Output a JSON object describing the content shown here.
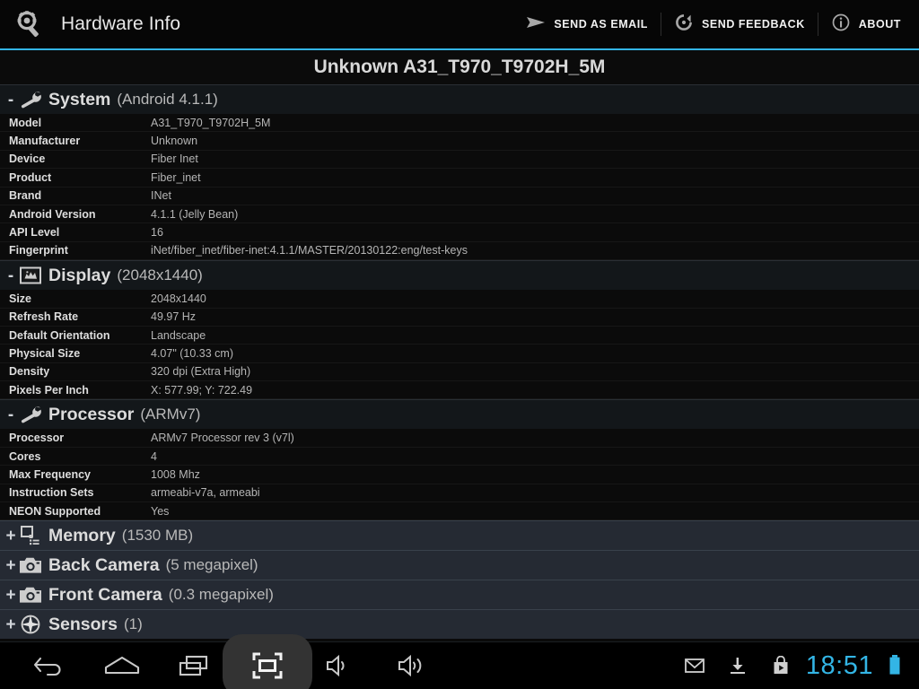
{
  "actionbar": {
    "app_icon": "magnifier-gear-icon",
    "title": "Hardware Info",
    "actions": [
      {
        "icon": "send-icon",
        "label": "SEND AS EMAIL"
      },
      {
        "icon": "feedback-refresh-icon",
        "label": "SEND FEEDBACK"
      },
      {
        "icon": "info-icon",
        "label": "ABOUT"
      }
    ],
    "accent_color": "#33b5e5"
  },
  "device_title": "Unknown A31_T970_T9702H_5M",
  "sections": [
    {
      "id": "system",
      "icon": "wrench-icon",
      "toggle": "-",
      "expanded": true,
      "name": "System",
      "sub": "(Android 4.1.1)",
      "rows": [
        {
          "key": "Model",
          "value": "A31_T970_T9702H_5M"
        },
        {
          "key": "Manufacturer",
          "value": "Unknown"
        },
        {
          "key": "Device",
          "value": "Fiber Inet"
        },
        {
          "key": "Product",
          "value": "Fiber_inet"
        },
        {
          "key": "Brand",
          "value": "INet"
        },
        {
          "key": "Android Version",
          "value": "4.1.1 (Jelly Bean)"
        },
        {
          "key": "API Level",
          "value": "16"
        },
        {
          "key": "Fingerprint",
          "value": "iNet/fiber_inet/fiber-inet:4.1.1/MASTER/20130122:eng/test-keys"
        }
      ]
    },
    {
      "id": "display",
      "icon": "picture-frame-icon",
      "toggle": "-",
      "expanded": true,
      "name": "Display",
      "sub": "(2048x1440)",
      "rows": [
        {
          "key": "Size",
          "value": "2048x1440"
        },
        {
          "key": "Refresh Rate",
          "value": "49.97 Hz"
        },
        {
          "key": "Default Orientation",
          "value": "Landscape"
        },
        {
          "key": "Physical Size",
          "value": "4.07\" (10.33 cm)"
        },
        {
          "key": "Density",
          "value": "320 dpi (Extra High)"
        },
        {
          "key": "Pixels Per Inch",
          "value": "X: 577.99; Y: 722.49"
        }
      ]
    },
    {
      "id": "processor",
      "icon": "wrench-icon",
      "toggle": "-",
      "expanded": true,
      "name": "Processor",
      "sub": "(ARMv7)",
      "rows": [
        {
          "key": "Processor",
          "value": "ARMv7 Processor rev 3 (v7l)"
        },
        {
          "key": "Cores",
          "value": "4"
        },
        {
          "key": "Max Frequency",
          "value": "1008 Mhz"
        },
        {
          "key": "Instruction Sets",
          "value": "armeabi-v7a, armeabi"
        },
        {
          "key": "NEON Supported",
          "value": "Yes"
        }
      ]
    },
    {
      "id": "memory",
      "icon": "memory-chip-icon",
      "toggle": "+",
      "expanded": false,
      "name": "Memory",
      "sub": "(1530 MB)",
      "rows": []
    },
    {
      "id": "back-camera",
      "icon": "camera-icon",
      "toggle": "+",
      "expanded": false,
      "name": "Back Camera",
      "sub": "(5 megapixel)",
      "rows": []
    },
    {
      "id": "front-camera",
      "icon": "camera-icon",
      "toggle": "+",
      "expanded": false,
      "name": "Front Camera",
      "sub": "(0.3 megapixel)",
      "rows": []
    },
    {
      "id": "sensors",
      "icon": "compass-icon",
      "toggle": "+",
      "expanded": false,
      "name": "Sensors",
      "sub": "(1)",
      "rows": []
    }
  ],
  "navbar": {
    "buttons": [
      {
        "icon": "back-icon",
        "active": false
      },
      {
        "icon": "home-icon",
        "active": false
      },
      {
        "icon": "recents-icon",
        "active": false
      },
      {
        "icon": "screenshot-icon",
        "active": true
      },
      {
        "icon": "volume-down-icon",
        "active": false
      },
      {
        "icon": "volume-up-icon",
        "active": false
      }
    ],
    "status_icons": [
      {
        "icon": "gmail-icon"
      },
      {
        "icon": "download-icon"
      },
      {
        "icon": "play-store-icon"
      }
    ],
    "clock": "18:51",
    "clock_color": "#33b5e5",
    "battery": {
      "icon": "battery-full-icon",
      "color": "#33b5e5"
    }
  }
}
